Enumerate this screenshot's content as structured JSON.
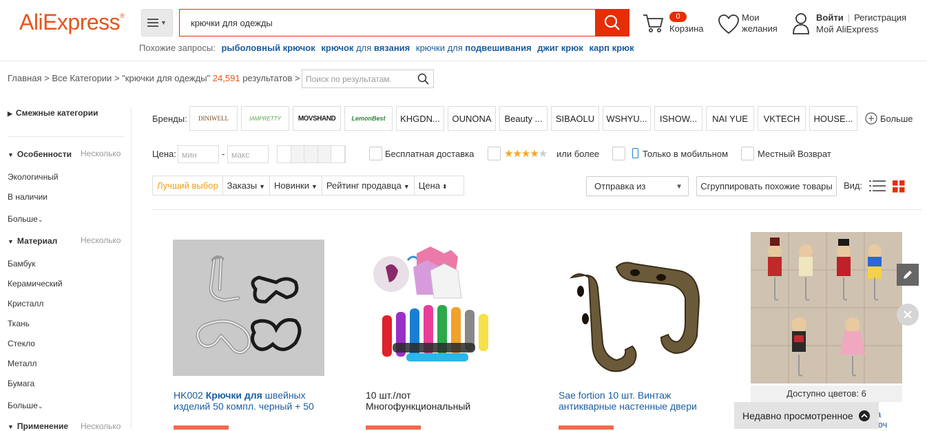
{
  "header": {
    "logo": "AliExpress",
    "logo_mark": "®",
    "search_value": "крючки для одежды",
    "cart_count": "0",
    "cart_label": "Корзина",
    "wishlist_line1": "Мои",
    "wishlist_line2": "желания",
    "login": "Войти",
    "register": "Регистрация",
    "my_account": "Мой AliExpress"
  },
  "related": {
    "label": "Похожие запросы:",
    "items": [
      {
        "b1": "рыболовный крючок",
        "n1": "",
        "b2": ""
      },
      {
        "b1": "крючок",
        "n1": " для ",
        "b2": "вязания"
      },
      {
        "b1": "",
        "n1": "крючки для ",
        "b2": "подвешивания"
      },
      {
        "b1": "джиг крюк",
        "n1": "",
        "b2": ""
      },
      {
        "b1": "карп крюк",
        "n1": "",
        "b2": ""
      }
    ]
  },
  "breadcrumb": {
    "home": "Главная",
    "sep": " > ",
    "all": "Все Категории",
    "query": "\"крючки для одежды\"",
    "count": "24,591",
    "results": "результатов",
    "search_placeholder": "Поиск по результатам."
  },
  "sidebar": {
    "related_cats": "Смежные категории",
    "features": "Особенности",
    "any": "Несколько",
    "feature_items": [
      "Экологичный",
      "В наличии"
    ],
    "more": "Больше",
    "material": "Материал",
    "material_items": [
      "Бамбук",
      "Керамический",
      "Кристалл",
      "Ткань",
      "Стекло",
      "Металл",
      "Бумага"
    ],
    "application": "Применение"
  },
  "brands": {
    "label": "Бренды:",
    "items": [
      "DINIWELL",
      "IAMPRETTY",
      "MOVSHAND",
      "LemonBest",
      "KHGDN...",
      "OUNONA",
      "Beauty ...",
      "SIBAOLU",
      "WSHYU...",
      "ISHOW...",
      "NAI YUE",
      "VKTECH",
      "HOUSE..."
    ],
    "more": "Больше"
  },
  "filters": {
    "price": "Цена:",
    "min": "мин",
    "max": "макс",
    "dash": "-",
    "free_shipping": "Бесплатная доставка",
    "rating_suffix": "или более",
    "mobile_only": "Только в мобильном",
    "local_return": "Местный Возврат"
  },
  "sort": {
    "best": "Лучший выбор",
    "orders": "Заказы",
    "newest": "Новинки",
    "seller_rating": "Рейтинг продавца",
    "price": "Цена",
    "ship_from": "Отправка из",
    "group_similar": "Сгруппировать похожие товары",
    "view": "Вид:"
  },
  "products": [
    {
      "t1": "HK002 ",
      "bold": "Крючки для",
      "t2": " швейных изделий 50 компл. черный + 50"
    },
    {
      "t1": "10 шт./лот Многофункциональный",
      "bold": "",
      "t2": ""
    },
    {
      "t1": "Sae fortion 10 шт. Винтаж антикварные настенные двери",
      "bold": "",
      "t2": ""
    },
    {
      "colors": "Доступно цветов: 6",
      "tail1": "а",
      "tail2": "юч"
    }
  ],
  "recent": "Недавно просмотренное",
  "colors": {
    "accent": "#e62e04",
    "logo": "#e8541a",
    "link": "#1a5da0",
    "sort_active": "#f39c12",
    "star": "#f5a623"
  }
}
